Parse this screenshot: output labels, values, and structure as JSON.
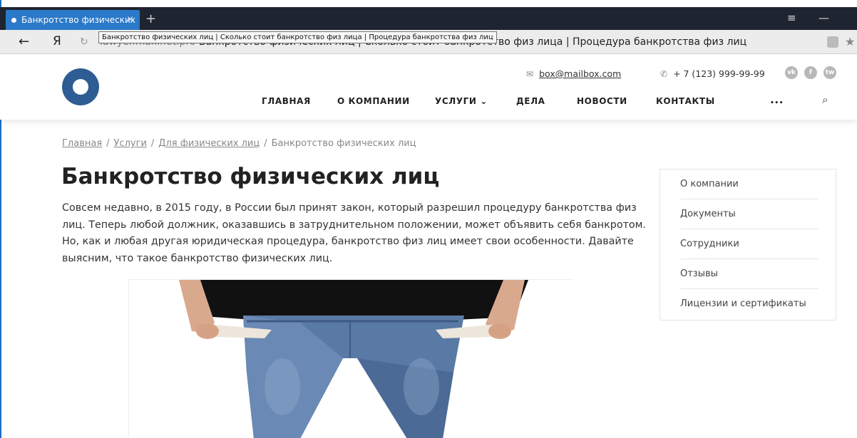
{
  "browser": {
    "tab_title": "Банкротство физических",
    "tab_close": "×",
    "new_tab": "+",
    "menu_glyph": "≡",
    "minimize_glyph": "—",
    "back_glyph": "←",
    "yandex_glyph": "Я",
    "reload_glyph": "↻",
    "address_host": "lawyer.maxinet.pro",
    "address_title": "Банкротство физических лиц | Сколько стоит банкротство физ лица | Процедура банкротства физ лиц",
    "tooltip": "Банкротство физических лиц | Сколько стоит банкротство физ лица | Процедура банкротства физ лиц"
  },
  "header": {
    "email": "box@mailbox.com",
    "phone": "+ 7 (123) 999-99-99",
    "social": [
      "vk",
      "f",
      "tw"
    ],
    "menu": [
      {
        "label": "ГЛАВНАЯ"
      },
      {
        "label": "О КОМПАНИИ"
      },
      {
        "label": "УСЛУГИ ⌄"
      },
      {
        "label": "ДЕЛА"
      },
      {
        "label": "НОВОСТИ"
      },
      {
        "label": "КОНТАКТЫ"
      },
      {
        "label": "•••"
      }
    ]
  },
  "breadcrumbs": {
    "home": "Главная",
    "services": "Услуги",
    "individuals": "Для физических лиц",
    "current": "Банкротство физических лиц",
    "separator": "/"
  },
  "page": {
    "title": "Банкротство физических лиц",
    "intro": "Совсем недавно, в 2015 году, в России был принят закон, который разрешил процедуру банкротства физ лиц. Теперь любой должник, оказавшись в затруднительном положении, может объявить себя банкротом. Но, как и любая другая юридическая процедура, банкротство физ лиц имеет свои особенности. Давайте выясним, что такое банкротство физических лиц."
  },
  "sidebar": {
    "items": [
      {
        "label": "О компании"
      },
      {
        "label": "Документы"
      },
      {
        "label": "Сотрудники"
      },
      {
        "label": "Отзывы"
      },
      {
        "label": "Лицензии и сертификаты"
      }
    ]
  },
  "colors": {
    "logo": "#2d5d93",
    "tab_active": "#2b79c9",
    "tabbar": "#1e2430"
  }
}
